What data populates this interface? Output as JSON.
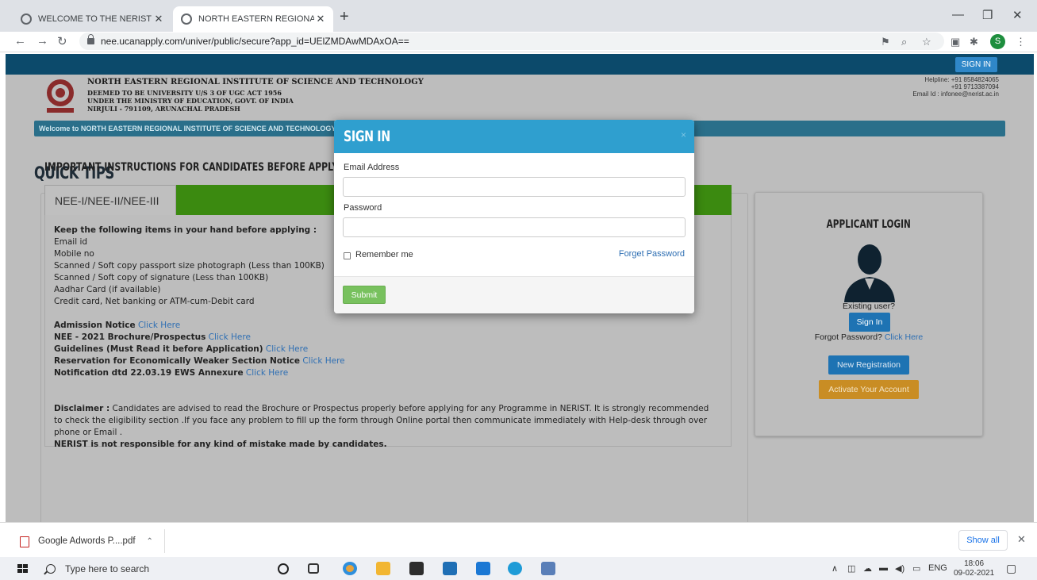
{
  "browser": {
    "tabs": [
      {
        "title": "WELCOME TO THE NERIST WEB (",
        "active": false
      },
      {
        "title": "NORTH EASTERN REGIONAL INS",
        "active": true
      }
    ],
    "new_tab": "+",
    "window_controls": {
      "minimize": "—",
      "restore": "❐",
      "close": "✕"
    },
    "url": "nee.ucanapply.com/univer/public/secure?app_id=UElZMDAwMDAxOA==",
    "profile_initial": "S"
  },
  "site": {
    "signin_top": "SIGN IN",
    "institute_name": "NORTH EASTERN REGIONAL INSTITUTE OF SCIENCE AND TECHNOLOGY",
    "institute_lines": [
      "DEEMED TO BE UNIVERSITY U/S 3 OF UGC ACT 1956",
      "UNDER THE MINISTRY OF EDUCATION, GOVT. OF INDIA",
      "NIRJULI - 791109, ARUNACHAL PRADESH"
    ],
    "helpline": [
      "Helpline: +91 8584824065",
      "+91 9713387094",
      "Email Id : infonee@nerist.ac.in"
    ],
    "welcome_text": "Welcome to NORTH EASTERN REGIONAL INSTITUTE OF SCIENCE AND TECHNOLOGY",
    "quick_tips": "QUICK TIPS",
    "instructions_title": "IMPORTANT INSTRUCTIONS FOR CANDIDATES BEFORE APPLYING ONLINE",
    "tab_label": "NEE-I/NEE-II/NEE-III",
    "keep_heading": "Keep the following items in your hand before applying :",
    "keep_items": [
      "Email id",
      "Mobile no",
      "Scanned / Soft copy passport size photograph (Less than 100KB)",
      "Scanned / Soft copy of signature (Less than 100KB)",
      "Aadhar Card (if available)",
      "Credit card, Net banking or ATM-cum-Debit card"
    ],
    "notices": [
      {
        "label": "Admission Notice",
        "link": "Click Here"
      },
      {
        "label": "NEE - 2021 Brochure/Prospectus",
        "link": "Click Here"
      },
      {
        "label": "Guidelines (Must Read it before Application)",
        "link": "Click Here"
      },
      {
        "label": "Reservation for Economically Weaker Section Notice",
        "link": "Click Here"
      },
      {
        "label": "Notification dtd 22.03.19 EWS Annexure",
        "link": "Click Here"
      }
    ],
    "disclaimer_label": "Disclaimer :",
    "disclaimer_text": "Candidates are advised to read the Brochure or Prospectus properly before applying for any Programme in NERIST. It is strongly recommended to check the eligibility section .If you face any problem to fill up the form through Online portal then communicate immediately with Help-desk through over phone or Email .",
    "disclaimer_bold": "NERIST is not responsible for any kind of mistake made by candidates.",
    "applicant_login": {
      "title": "APPLICANT LOGIN",
      "existing_user": "Existing user?",
      "signin_button": "Sign In",
      "forgot_prefix": "Forgot Password?",
      "forgot_link": "Click Here",
      "new_registration": "New Registration",
      "activate_account": "Activate Your Account"
    }
  },
  "modal": {
    "title": "SIGN IN",
    "close": "×",
    "email_label": "Email Address",
    "email_value": "",
    "password_label": "Password",
    "password_value": "",
    "remember_label": "Remember me",
    "forget_link": "Forget Password",
    "submit": "Submit"
  },
  "downloads": {
    "file": "Google Adwords P....pdf",
    "show_all": "Show all",
    "close": "✕"
  },
  "taskbar": {
    "search_placeholder": "Type here to search",
    "language": "ENG",
    "time": "18:06",
    "date": "09-02-2021"
  },
  "colors": {
    "modal_header": "#2f9fcf",
    "green_tab": "#3b8a10",
    "link": "#2f6fb3",
    "submit": "#78c15e",
    "activate": "#c98d24"
  }
}
